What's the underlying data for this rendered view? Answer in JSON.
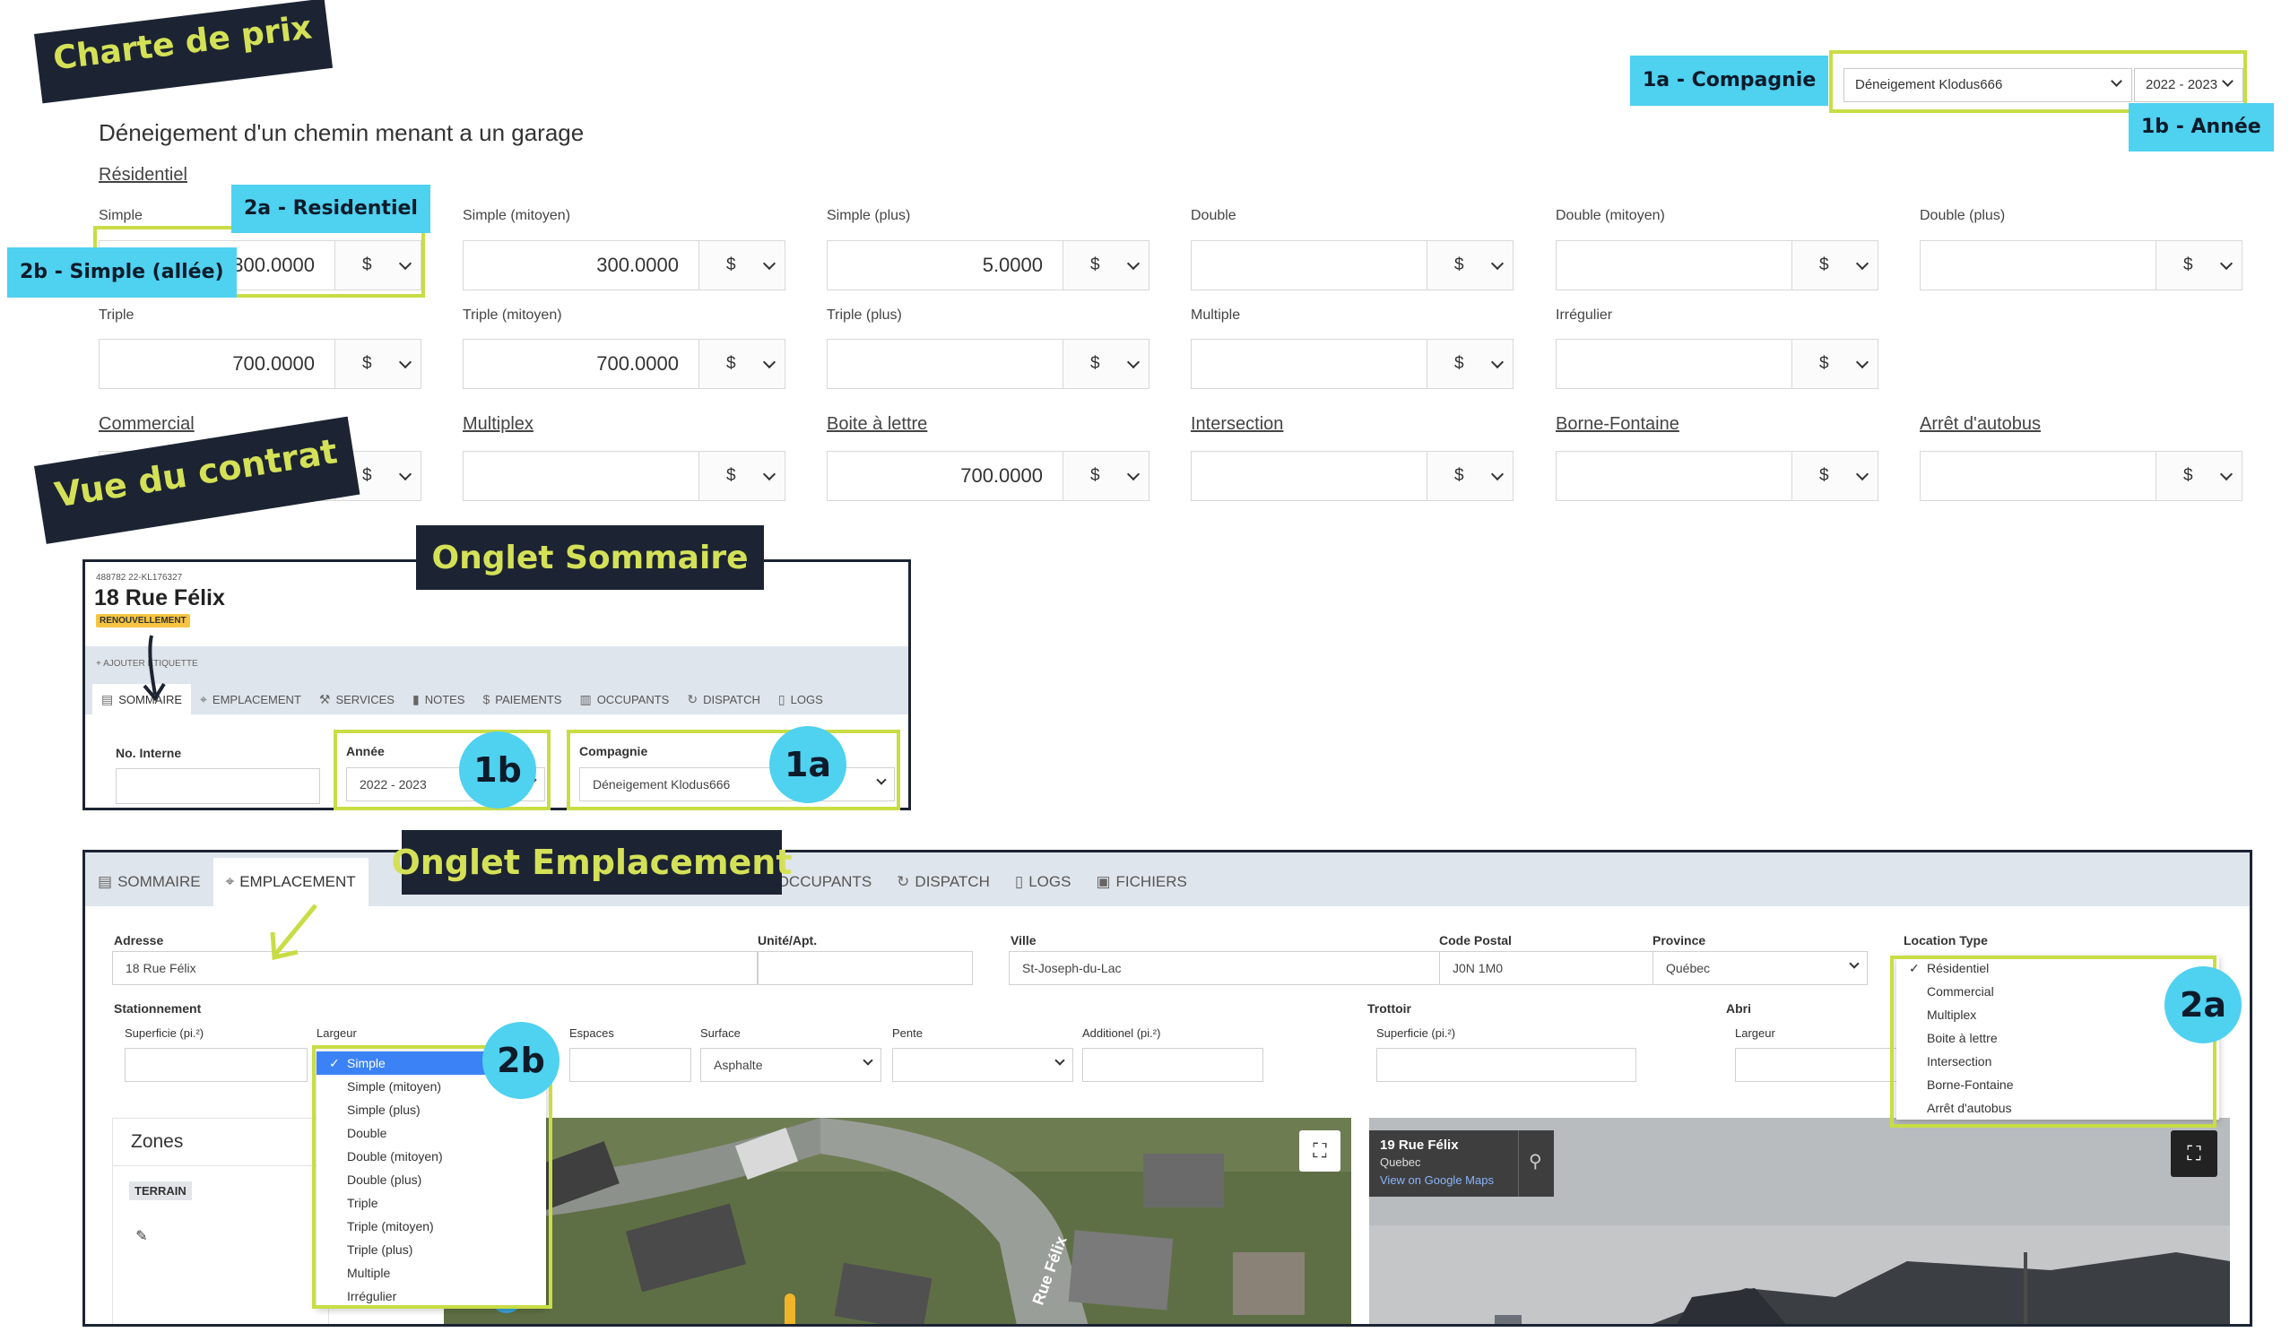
{
  "chart": {
    "banner": "Charte de prix",
    "title": "Déneigement d'un chemin menant a un garage",
    "company_tag": "1a - Compagnie",
    "year_tag": "1b - Année",
    "company_value": "Déneigement Klodus666",
    "year_value": "2022 - 2023",
    "residentiel_link": "Résidentiel",
    "tag_residentiel": "2a - Residentiel",
    "tag_simple": "2b - Simple (allée)",
    "currency": "$",
    "rows": [
      [
        {
          "label": "Simple",
          "value": "300.0000"
        },
        {
          "label": "Simple (mitoyen)",
          "value": "300.0000"
        },
        {
          "label": "Simple (plus)",
          "value": "5.0000"
        },
        {
          "label": "Double",
          "value": ""
        },
        {
          "label": "Double (mitoyen)",
          "value": ""
        },
        {
          "label": "Double (plus)",
          "value": ""
        }
      ],
      [
        {
          "label": "Triple",
          "value": "700.0000"
        },
        {
          "label": "Triple (mitoyen)",
          "value": "700.0000"
        },
        {
          "label": "Triple (plus)",
          "value": ""
        },
        {
          "label": "Multiple",
          "value": ""
        },
        {
          "label": "Irrégulier",
          "value": ""
        }
      ],
      [
        {
          "label": "Commercial",
          "value": ""
        },
        {
          "label": "Multiplex",
          "value": ""
        },
        {
          "label": "Boite à lettre",
          "value": "700.0000"
        },
        {
          "label": "Intersection",
          "value": ""
        },
        {
          "label": "Borne-Fontaine",
          "value": ""
        },
        {
          "label": "Arrêt d'autobus",
          "value": ""
        }
      ]
    ]
  },
  "contract": {
    "banner": "Vue du contrat"
  },
  "sommaire": {
    "banner": "Onglet Sommaire",
    "ids": "488782   22-KL176327",
    "address": "18 Rue Félix",
    "status": "RENOUVELLEMENT",
    "add_tag": "+ AJOUTER ÉTIQUETTE",
    "tabs": [
      "SOMMAIRE",
      "EMPLACEMENT",
      "SERVICES",
      "NOTES",
      "PAIEMENTS",
      "OCCUPANTS",
      "DISPATCH",
      "LOGS"
    ],
    "no_interne_label": "No. Interne",
    "annee_label": "Année",
    "annee_value": "2022 - 2023",
    "compagnie_label": "Compagnie",
    "compagnie_value": "Déneigement Klodus666",
    "badge_1b": "1b",
    "badge_1a": "1a"
  },
  "emplacement": {
    "banner": "Onglet Emplacement",
    "tabs": [
      "SOMMAIRE",
      "EMPLACEMENT",
      "OCCUPANTS",
      "DISPATCH",
      "LOGS",
      "FICHIERS"
    ],
    "adresse_label": "Adresse",
    "adresse_value": "18 Rue Félix",
    "unite_label": "Unité/Apt.",
    "ville_label": "Ville",
    "ville_value": "St-Joseph-du-Lac",
    "code_postal_label": "Code Postal",
    "code_postal_value": "J0N 1M0",
    "province_label": "Province",
    "province_value": "Québec",
    "location_type_label": "Location Type",
    "location_types": [
      "Résidentiel",
      "Commercial",
      "Multiplex",
      "Boite à lettre",
      "Intersection",
      "Borne-Fontaine",
      "Arrêt d'autobus"
    ],
    "stationnement_label": "Stationnement",
    "superficie_label": "Superficie (pi.²)",
    "largeur_label": "Largeur",
    "largeur_options": [
      "Simple",
      "Simple (mitoyen)",
      "Simple (plus)",
      "Double",
      "Double (mitoyen)",
      "Double (plus)",
      "Triple",
      "Triple (mitoyen)",
      "Triple (plus)",
      "Multiple",
      "Irrégulier"
    ],
    "espaces_label": "Espaces",
    "surface_label": "Surface",
    "surface_value": "Asphalte",
    "pente_label": "Pente",
    "additionel_label": "Additionel (pi.²)",
    "trottoir_label": "Trottoir",
    "trottoir_superficie_label": "Superficie (pi.²)",
    "abri_label": "Abri",
    "abri_largeur_label": "Largeur",
    "zones_label": "Zones",
    "terrain_badge": "TERRAIN",
    "street_label": "Rue Félix",
    "streetview_title": "19 Rue Félix",
    "streetview_sub": "Quebec",
    "streetview_link": "View on Google Maps",
    "badge_2b": "2b",
    "badge_2a": "2a"
  }
}
